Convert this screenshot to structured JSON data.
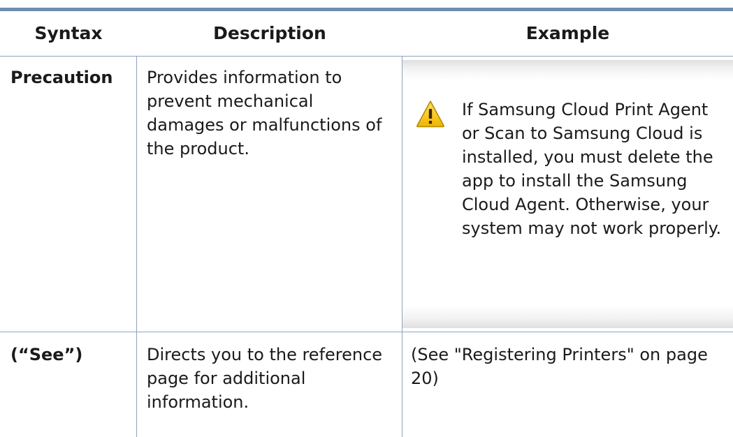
{
  "table": {
    "headers": {
      "syntax": "Syntax",
      "description": "Description",
      "example": "Example"
    },
    "rows": [
      {
        "syntax": "Precaution",
        "description": "Provides information to prevent mechanical damages or malfunctions of the product.",
        "example_icon": "caution-triangle-icon",
        "example": "If Samsung Cloud Print Agent or Scan to Samsung Cloud is installed, you must delete the app to install the Samsung Cloud Agent. Otherwise, your system may not work properly."
      },
      {
        "syntax": "(“See”)",
        "description": "Directs you to the reference page for additional information.",
        "example": "(See \"Registering Printers\" on page 20)"
      }
    ]
  },
  "colors": {
    "rule": "#6f8db0",
    "gridline": "#8fa4bd",
    "icon_fill": "#f5c400",
    "icon_outline": "#b08a00"
  }
}
